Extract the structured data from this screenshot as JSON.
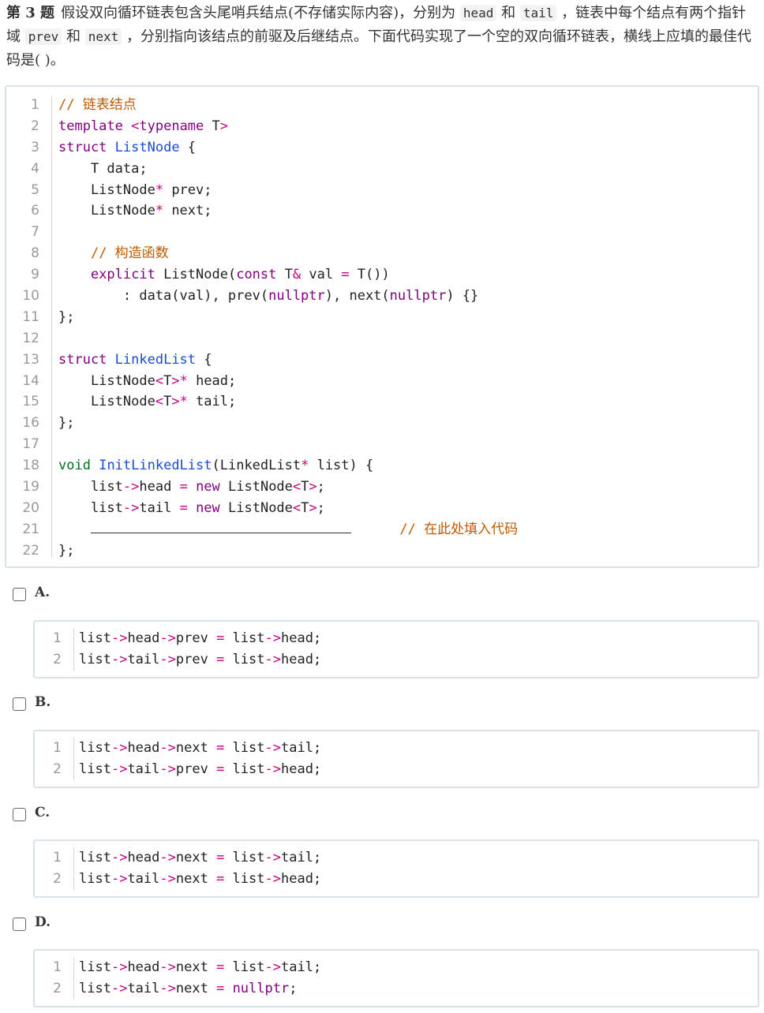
{
  "question": {
    "number": "第 3 题",
    "text_parts": [
      "假设双向循环链表包含头尾哨兵结点(不存储实际内容)，分别为 ",
      "head",
      " 和 ",
      "tail",
      " ，链表中每个结点有两个指针域 ",
      "prev",
      " 和 ",
      "next",
      " ，分别指向该结点的前驱及后继结点。下面代码实现了一个空的双向循环链表，横线上应填的最佳代码是( )。"
    ]
  },
  "main_code": {
    "line_numbers": [
      "1",
      "2",
      "3",
      "4",
      "5",
      "6",
      "7",
      "8",
      "9",
      "10",
      "11",
      "12",
      "13",
      "14",
      "15",
      "16",
      "17",
      "18",
      "19",
      "20",
      "21",
      "22"
    ],
    "lines": [
      "// 链表结点",
      "template <typename T>",
      "struct ListNode {",
      "    T data;",
      "    ListNode* prev;",
      "    ListNode* next;",
      "",
      "    // 构造函数",
      "    explicit ListNode(const T& val = T())",
      "        : data(val), prev(nullptr), next(nullptr) {}",
      "};",
      "",
      "struct LinkedList {",
      "    ListNode<T>* head;",
      "    ListNode<T>* tail;",
      "};",
      "",
      "void InitLinkedList(LinkedList* list) {",
      "    list->head = new ListNode<T>;",
      "    list->tail = new ListNode<T>;",
      "    ",
      "};"
    ],
    "blank_comment": "// 在此处填入代码"
  },
  "options": [
    {
      "label": "A.",
      "line_numbers": [
        "1",
        "2"
      ],
      "lines": [
        "list->head->prev = list->head;",
        "list->tail->prev = list->head;"
      ]
    },
    {
      "label": "B.",
      "line_numbers": [
        "1",
        "2"
      ],
      "lines": [
        "list->head->next = list->tail;",
        "list->tail->prev = list->head;"
      ]
    },
    {
      "label": "C.",
      "line_numbers": [
        "1",
        "2"
      ],
      "lines": [
        "list->head->next = list->tail;",
        "list->tail->next = list->head;"
      ]
    },
    {
      "label": "D.",
      "line_numbers": [
        "1",
        "2"
      ],
      "lines": [
        "list->head->next = list->tail;",
        "list->tail->next = nullptr;"
      ]
    }
  ]
}
